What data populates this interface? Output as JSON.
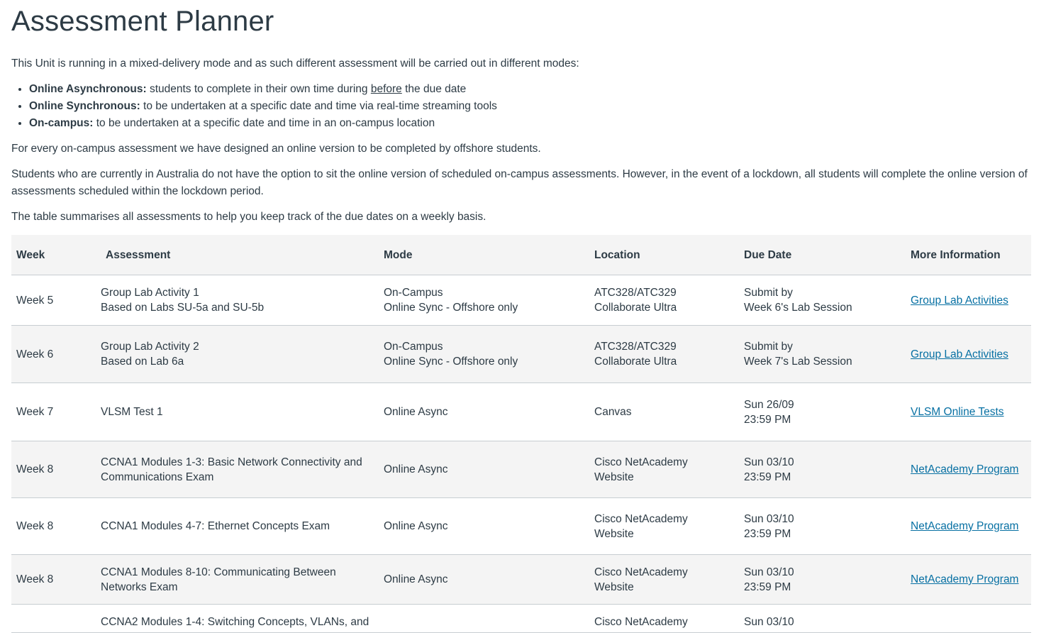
{
  "title": "Assessment Planner",
  "intro": "This Unit is running in a mixed-delivery mode and as such different assessment will be carried out in different modes:",
  "modes": [
    {
      "term": "Online Asynchronous:",
      "pre": " students to complete in their own time during ",
      "em": "before",
      "post": " the due date"
    },
    {
      "term": "Online Synchronous:",
      "pre": " to be undertaken at a specific date and time via real-time streaming tools",
      "em": "",
      "post": ""
    },
    {
      "term": "On-campus:",
      "pre": " to be undertaken at a specific date and time in an on-campus location",
      "em": "",
      "post": ""
    }
  ],
  "para1": "For every on-campus assessment we have designed an online version to be completed by offshore students.",
  "para2a": "Students who are currently in Australia do not have the option to sit the online version of scheduled on-campus assessments. However, in the event of a lockdown, all students will complete the online version of",
  "para2b": "assessments scheduled within the lockdown period.",
  "para3": "The table summarises all assessments to help you keep track of the due dates on a weekly basis.",
  "table": {
    "headers": [
      "Week",
      "Assessment",
      "Mode",
      "Location",
      "Due Date",
      "More Information"
    ],
    "rows": [
      {
        "week": "Week 5",
        "assessment": [
          "Group Lab Activity 1",
          "Based on Labs SU-5a and SU-5b"
        ],
        "mode": [
          "On-Campus",
          "Online Sync - Offshore only"
        ],
        "location": [
          "ATC328/ATC329",
          "Collaborate Ultra"
        ],
        "due": [
          "Submit by",
          "Week 6's Lab Session"
        ],
        "link": "Group Lab Activities"
      },
      {
        "week": "Week 6",
        "assessment": [
          "Group Lab Activity 2",
          "Based on Lab 6a"
        ],
        "mode": [
          "On-Campus",
          "Online Sync - Offshore only"
        ],
        "location": [
          "ATC328/ATC329",
          "Collaborate Ultra"
        ],
        "due": [
          "Submit by",
          "Week 7's Lab Session"
        ],
        "link": "Group Lab Activities"
      },
      {
        "week": "Week 7",
        "assessment": [
          "VLSM Test 1"
        ],
        "mode": [
          "Online Async"
        ],
        "location": [
          "Canvas"
        ],
        "due": [
          "Sun 26/09",
          "23:59 PM"
        ],
        "link": "VLSM Online Tests"
      },
      {
        "week": "Week 8",
        "assessment": [
          "CCNA1 Modules 1-3: Basic Network Connectivity and",
          "Communications Exam"
        ],
        "mode": [
          "Online Async"
        ],
        "location": [
          "Cisco NetAcademy",
          "Website"
        ],
        "due": [
          "Sun 03/10",
          "23:59 PM"
        ],
        "link": "NetAcademy Program"
      },
      {
        "week": "Week 8",
        "assessment": [
          "CCNA1 Modules 4-7: Ethernet Concepts Exam"
        ],
        "mode": [
          "Online Async"
        ],
        "location": [
          "Cisco NetAcademy",
          "Website"
        ],
        "due": [
          "Sun 03/10",
          "23:59 PM"
        ],
        "link": "NetAcademy Program"
      },
      {
        "week": "Week 8",
        "assessment": [
          "CCNA1 Modules 8-10: Communicating Between",
          "Networks Exam"
        ],
        "mode": [
          "Online Async"
        ],
        "location": [
          "Cisco NetAcademy",
          "Website"
        ],
        "due": [
          "Sun 03/10",
          "23:59 PM"
        ],
        "link": "NetAcademy Program"
      },
      {
        "week": "",
        "assessment": [
          "CCNA2 Modules 1-4: Switching Concepts, VLANs, and"
        ],
        "mode": [
          ""
        ],
        "location": [
          "Cisco NetAcademy"
        ],
        "due": [
          "Sun 03/10"
        ],
        "link": ""
      }
    ]
  }
}
